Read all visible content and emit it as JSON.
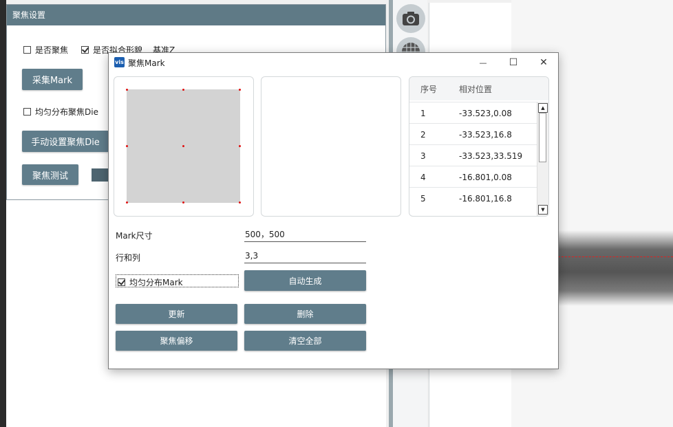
{
  "background_panel": {
    "title": "聚焦设置",
    "check_focus_label": "是否聚焦",
    "check_fit_label": "是否拟合形貌",
    "ref_z_label": "基准Z",
    "collect_mark_label": "采集Mark",
    "uniform_die_label": "均匀分布聚焦Die",
    "manual_die_label": "手动设置聚焦Die",
    "focus_test_label": "聚焦测试"
  },
  "dialog": {
    "app_icon": "vis",
    "title": "聚焦Mark",
    "minimize_icon": "—",
    "maximize_icon": "☐",
    "close_icon": "✕",
    "table": {
      "col_index": "序号",
      "col_position": "相对位置",
      "rows": [
        {
          "index": "1",
          "position": "-33.523,0.08"
        },
        {
          "index": "2",
          "position": "-33.523,16.8"
        },
        {
          "index": "3",
          "position": "-33.523,33.519"
        },
        {
          "index": "4",
          "position": "-16.801,0.08"
        },
        {
          "index": "5",
          "position": "-16.801,16.8"
        }
      ]
    },
    "mark_size_label": "Mark尺寸",
    "mark_size_value": "500，500",
    "rows_cols_label": "行和列",
    "rows_cols_value": "3,3",
    "uniform_mark_label": "均匀分布Mark",
    "auto_generate_label": "自动生成",
    "update_label": "更新",
    "delete_label": "删除",
    "focus_offset_label": "聚焦偏移",
    "clear_all_label": "清空全部"
  },
  "colors": {
    "accent": "#607d8b",
    "marker": "#e01010"
  }
}
